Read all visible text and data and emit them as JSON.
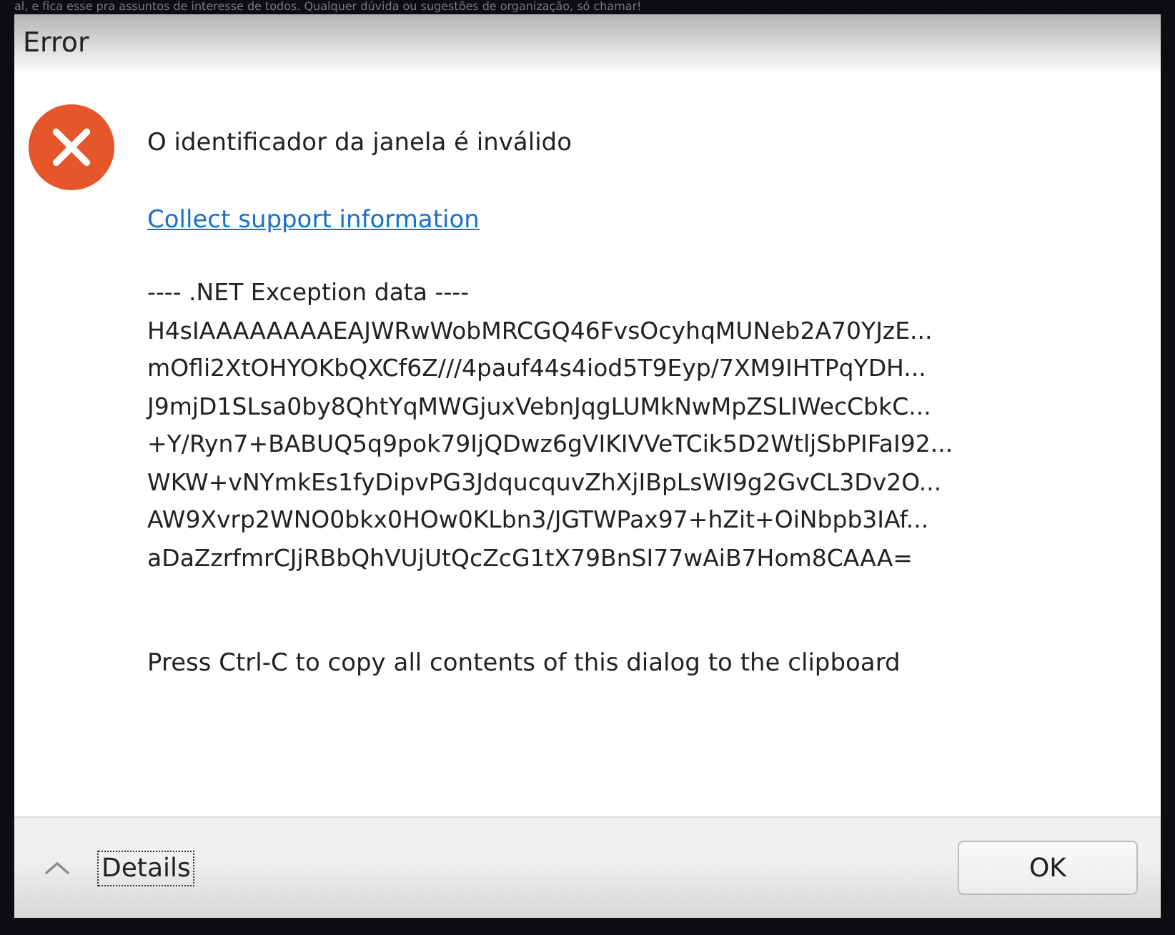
{
  "background": {
    "text": "al, e fica esse pra assuntos de interesse de todos. Qualquer dúvida ou sugestões de organização, só chamar!"
  },
  "window": {
    "title": "Error"
  },
  "message": "O identificador da janela é inválido",
  "link": "Collect support information",
  "details_lines": [
    "---- .NET Exception data ----",
    "H4sIAAAAAAAAEAJWRwWobMRCGQ46FvsOcyhqMUNeb2A70YJzE...",
    "mOfli2XtOHYOKbQXCf6Z///4pauf44s4iod5T9Eyp/7XM9IHTPqYDH...",
    "J9mjD1SLsa0by8QhtYqMWGjuxVebnJqgLUMkNwMpZSLIWecCbkC...",
    "+Y/Ryn7+BABUQ5q9pok79IjQDwz6gVIKIVVeTCik5D2WtljSbPIFaI92...",
    "WKW+vNYmkEs1fyDipvPG3JdqucquvZhXjIBpLsWI9g2GvCL3Dv2O...",
    "AW9Xvrp2WNO0bkx0HOw0KLbn3/JGTWPax97+hZit+OiNbpb3IAf...",
    "aDaZzrfmrCJjRBbQhVUjUtQcZcG1tX79BnSI77wAiB7Hom8CAAA="
  ],
  "hint": "Press Ctrl-C to copy all contents of this dialog to the clipboard",
  "footer": {
    "details_button": {
      "label": "Details",
      "expanded": true
    },
    "ok_button": "OK"
  }
}
